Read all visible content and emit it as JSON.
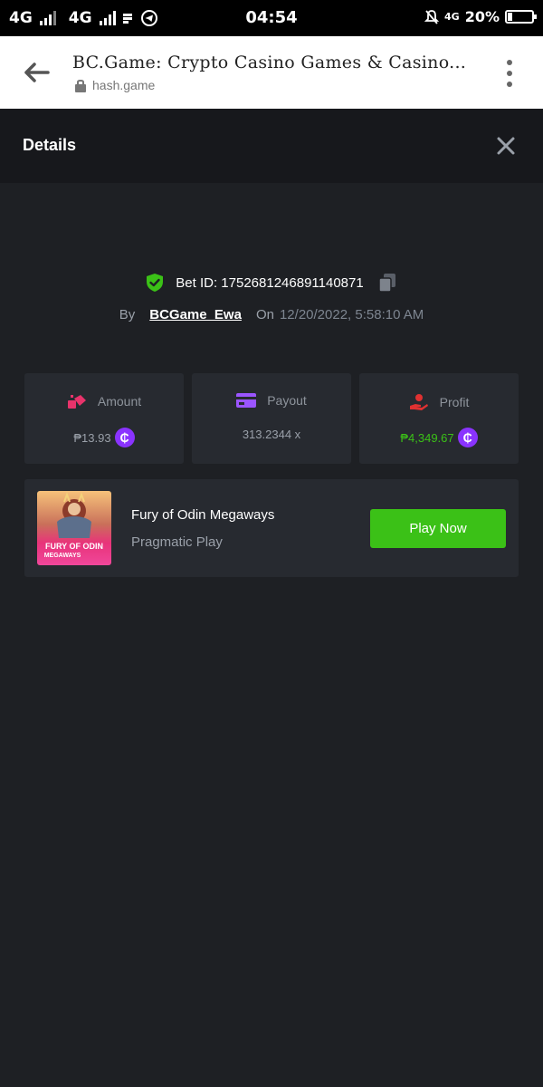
{
  "status_bar": {
    "net1": "4G",
    "net2": "4G",
    "time": "04:54",
    "net3": "4G",
    "battery": "20%",
    "battery_level": 0.2
  },
  "browser": {
    "title": "BC.Game: Crypto Casino Games & Casino...",
    "url": "hash.game"
  },
  "details": {
    "title": "Details"
  },
  "bet": {
    "id_label": "Bet ID: 1752681246891140871",
    "by_label": "By",
    "user": "BCGame_Ewa",
    "on_label": "On",
    "date": "12/20/2022, 5:58:10 AM"
  },
  "stats": {
    "amount": {
      "label": "Amount",
      "value": "₱13.93",
      "color": "#9aa0a9"
    },
    "payout": {
      "label": "Payout",
      "value": "313.2344 x"
    },
    "profit": {
      "label": "Profit",
      "value": "₱4,349.67",
      "color": "#3bc117"
    }
  },
  "game": {
    "name": "Fury of Odin Megaways",
    "provider": "Pragmatic Play",
    "play_label": "Play Now",
    "thumb_line1": "FURY OF ODIN",
    "thumb_line2": "MEGAWAYS"
  },
  "colors": {
    "accent_green": "#3bc117",
    "coin_purple": "#8a33ff",
    "bg": "#1e2024",
    "card": "#272a30"
  }
}
